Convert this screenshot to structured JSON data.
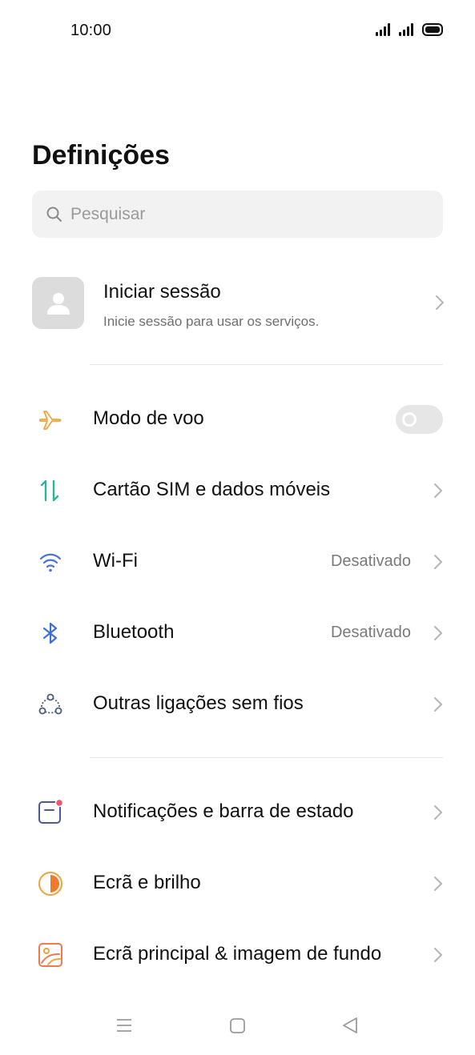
{
  "status_bar": {
    "time": "10:00",
    "icons": [
      "signal-icon",
      "signal-icon",
      "battery-icon"
    ]
  },
  "header": {
    "title": "Definições"
  },
  "search": {
    "placeholder": "Pesquisar",
    "value": ""
  },
  "account": {
    "title": "Iniciar sessão",
    "subtitle": "Inicie sessão para usar os serviços."
  },
  "rows": [
    {
      "label": "Modo de voo",
      "icon": "airplane-icon",
      "control": "toggle",
      "toggle_on": false,
      "value": ""
    },
    {
      "label": "Cartão SIM e dados móveis",
      "icon": "sim-data-icon",
      "control": "chevron",
      "value": ""
    },
    {
      "label": "Wi-Fi",
      "icon": "wifi-icon",
      "control": "chevron",
      "value": "Desativado"
    },
    {
      "label": "Bluetooth",
      "icon": "bluetooth-icon",
      "control": "chevron",
      "value": "Desativado"
    },
    {
      "label": "Outras ligações sem fios",
      "icon": "connections-icon",
      "control": "chevron",
      "value": ""
    },
    {
      "label": "Notificações e barra de estado",
      "icon": "notification-icon",
      "control": "chevron",
      "value": ""
    },
    {
      "label": "Ecrã e brilho",
      "icon": "brightness-icon",
      "control": "chevron",
      "value": ""
    },
    {
      "label": "Ecrã principal & imagem de fundo",
      "icon": "wallpaper-icon",
      "control": "chevron",
      "value": ""
    }
  ],
  "nav_bar": {
    "buttons": [
      "menu-icon",
      "home-icon",
      "back-icon"
    ]
  },
  "colors": {
    "airplane": "#f0a53d",
    "sim": "#2fb39a",
    "wifi": "#4a73d6",
    "bluetooth": "#3f6fd8",
    "connections": "#4b5b7a",
    "notification": "#4b5b8a",
    "notification_dot": "#f0566a",
    "brightness": "#f2a23a",
    "wallpaper": "#ef7a52",
    "search_bg": "#f2f2f2",
    "toggle_off": "#e6e6e6"
  }
}
